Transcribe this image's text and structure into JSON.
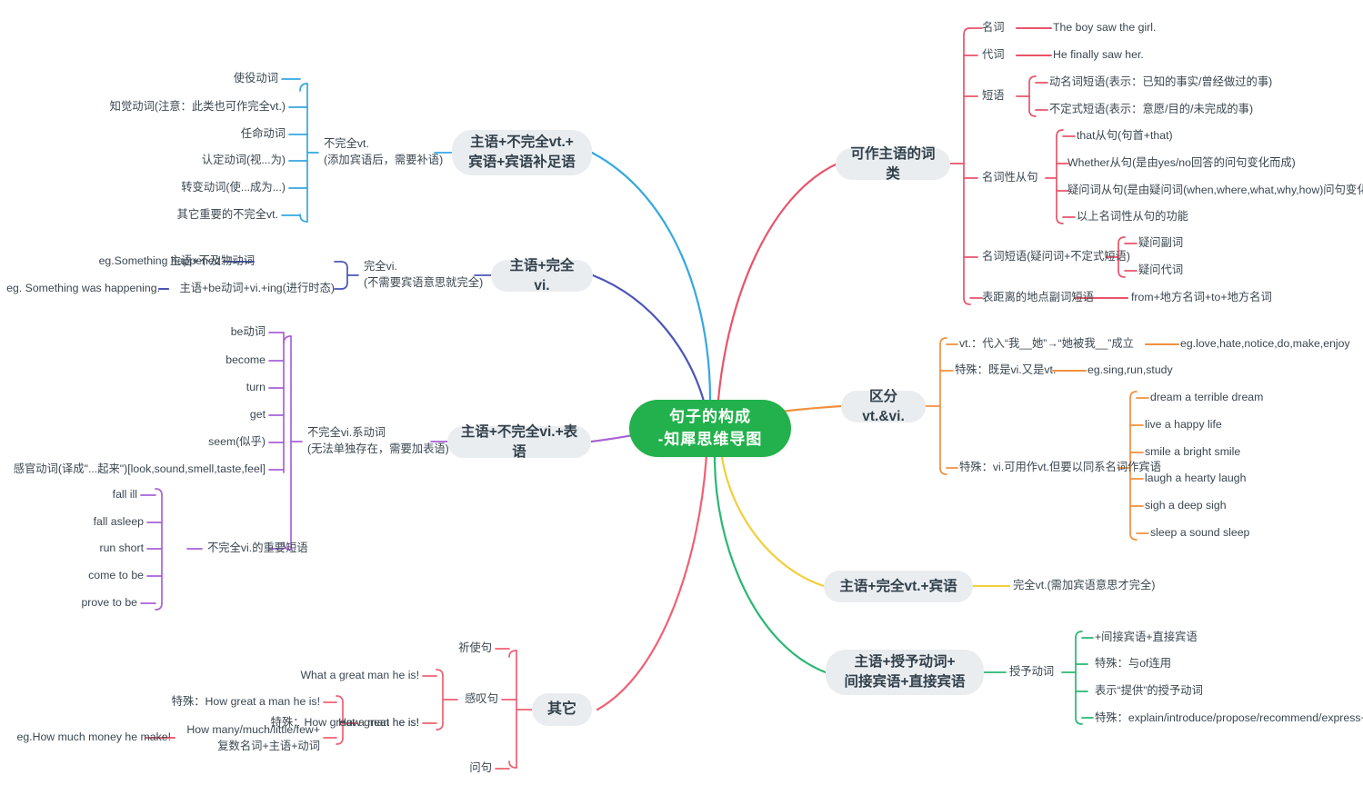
{
  "meta": {
    "title": "句子的构成-知犀思维导图",
    "type": "mindmap"
  },
  "colors": {
    "root_bg": "#22b14c",
    "pill_bg": "#eaedf0",
    "branch_cyan": "#35a8e0",
    "branch_blue": "#4a55b8",
    "branch_purple": "#a862d6",
    "branch_red": "#e8546a",
    "branch_red2": "#ef6073",
    "branch_orange": "#f0903f",
    "branch_yellow": "#f2cf3c",
    "branch_green": "#2bb673",
    "text": "#3a4750"
  },
  "root": {
    "line1": "句子的构成",
    "line2": "-知犀思维导图"
  },
  "branches": {
    "incomplete_vt": {
      "node": "主语+不完全vt.+\n宾语+宾语补足语",
      "node_l1": "主语+不完全vt.+",
      "node_l2": "宾语+宾语补足语",
      "mid_l1": "不完全vt.",
      "mid_l2": "(添加宾语后，需要补语)",
      "leaves": [
        "使役动词",
        "知觉动词(注意：此类也可作完全vt.)",
        "任命动词",
        "认定动词(视...为)",
        "转变动词(使...成为...)",
        "其它重要的不完全vt."
      ]
    },
    "complete_vi": {
      "node": "主语+完全vi.",
      "mid_l1": "完全vi.",
      "mid_l2": "(不需要宾语意思就完全)",
      "children": [
        {
          "label": "主语+不及物动词",
          "example": "eg.Something happened."
        },
        {
          "label": "主语+be动词+vi.+ing(进行时态)",
          "example": "eg. Something was happening."
        }
      ]
    },
    "incomplete_vi": {
      "node": "主语+不完全vi.+表语",
      "mid_l1": "不完全vi.系动词",
      "mid_l2": "(无法单独存在，需要加表语)",
      "linking_verbs": [
        "be动词",
        "become",
        "turn",
        "get",
        "seem(似乎)",
        "感官动词(译成\"...起来\")[look,sound,smell,taste,feel]"
      ],
      "phrases_label": "不完全vi.的重要短语",
      "phrases": [
        "fall ill",
        "fall asleep",
        "run short",
        "come to be",
        "prove to be"
      ]
    },
    "other": {
      "node": "其它",
      "items": [
        {
          "label": "祈使句"
        },
        {
          "label": "感叹句"
        },
        {
          "label": "问句"
        }
      ],
      "exclam_children": [
        "What a great man he is!",
        "How great he is!"
      ],
      "how_great_children": [
        "特殊：How great a man he is!",
        "How many/much/little/few+\n复数名词+主语+动词"
      ],
      "how_great_child_1": "特殊：How great a man he is!",
      "how_great_child_2_l1": "How many/much/little/few+",
      "how_great_child_2_l2": "复数名词+主语+动词",
      "how_many_example": "eg.How much money he make!"
    },
    "subject_word_classes": {
      "node": "可作主语的词类",
      "items": [
        {
          "label": "名词",
          "children": [
            "The boy saw the girl."
          ]
        },
        {
          "label": "代词",
          "children": [
            "He finally saw her."
          ]
        },
        {
          "label": "短语",
          "children": [
            "动名词短语(表示：已知的事实/曾经做过的事)",
            "不定式短语(表示：意愿/目的/未完成的事)"
          ]
        },
        {
          "label": "名词性从句",
          "children": [
            "that从句(句首+that)",
            "Whether从句(是由yes/no回答的问句变化而成)",
            "疑问词从句(是由疑问词(when,where,what,why,how)问句变化而成)",
            "以上名词性从句的功能"
          ]
        },
        {
          "label": "名词短语(疑问词+不定式短语)",
          "children": [
            "疑问副词",
            "疑问代词"
          ]
        },
        {
          "label": "表距离的地点副词短语",
          "children": [
            "from+地方名词+to+地方名词"
          ]
        }
      ]
    },
    "distinguish_vt_vi": {
      "node": "区分vt.&vi.",
      "items": [
        {
          "label": "vt.：代入“我__她”→“她被我__”成立",
          "children": [
            "eg.love,hate,notice,do,make,enjoy"
          ]
        },
        {
          "label": "特殊：既是vi.又是vt.",
          "children": [
            "eg.sing,run,study"
          ]
        },
        {
          "label": "特殊：vi.可用作vt.但要以同系名词作宾语",
          "children": [
            "dream a terrible dream",
            "live a happy life",
            "smile a bright smile",
            "laugh a hearty laugh",
            "sigh a deep sigh",
            "sleep a sound sleep"
          ]
        }
      ]
    },
    "complete_vt": {
      "node": "主语+完全vt.+宾语",
      "child": "完全vt.(需加宾语意思才完全)"
    },
    "ditransitive": {
      "node_l1": "主语+授予动词+",
      "node_l2": "间接宾语+直接宾语",
      "child_label": "授予动词",
      "grandchildren": [
        "+间接宾语+直接宾语",
        "特殊：与of连用",
        "表示“提供”的授予动词",
        "特殊：explain/introduce/propose/recommend/express+to"
      ]
    }
  }
}
